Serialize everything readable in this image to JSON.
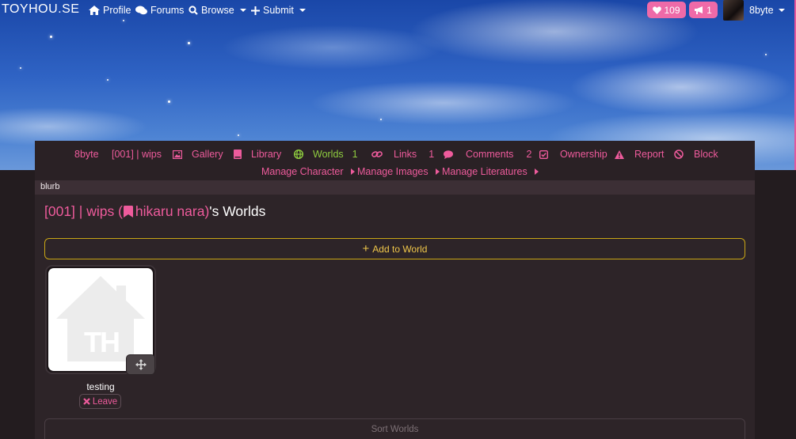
{
  "site": {
    "logo": "TOYHOU.SE"
  },
  "topnav": {
    "profile": "Profile",
    "forums": "Forums",
    "browse": "Browse",
    "submit": "Submit",
    "notifications_count": "109",
    "messages_count": "1",
    "username": "8byte"
  },
  "charnav": {
    "owner": "8byte",
    "character": "[001] | wips",
    "gallery": "Gallery",
    "library": "Library",
    "worlds": "Worlds",
    "worlds_count": "1",
    "links": "Links",
    "links_count": "1",
    "comments": "Comments",
    "comments_count": "2",
    "ownership": "Ownership",
    "report": "Report",
    "block": "Block",
    "manage_character": "Manage Character",
    "manage_images": "Manage Images",
    "manage_literatures": "Manage Literatures"
  },
  "blurb": "blurb",
  "page": {
    "title_prefix": "[001] | wips (",
    "title_name": "hikaru nara",
    "title_close": ")",
    "title_suffix": "'s Worlds",
    "add_to_world": "Add to World",
    "sort_worlds": "Sort Worlds"
  },
  "worlds": [
    {
      "name": "testing",
      "thumbnail_text": "TH",
      "leave_label": "Leave"
    }
  ],
  "colors": {
    "accent_pink": "#ee5b9c",
    "accent_green": "#8fcd3f",
    "accent_gold": "#c9a615",
    "panel_bg": "#2d2428"
  }
}
